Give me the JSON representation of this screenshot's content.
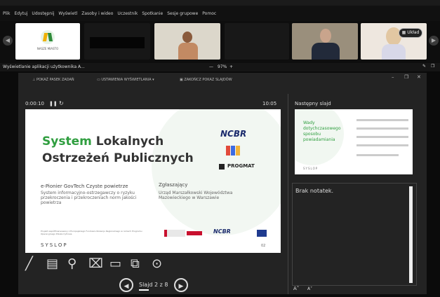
{
  "menu": [
    "Plik",
    "Edytuj",
    "Udostępnij",
    "Wyświetl",
    "Zasoby i wideo",
    "Uczestnik",
    "Spotkanie",
    "Sesje grupowe",
    "Pomoc"
  ],
  "gallery": {
    "logo_text": "NASZE MIASTO",
    "layout_label": "Układ"
  },
  "share": {
    "title": "Wyświetlanie aplikacji użytkownika A...",
    "zoom": "97%",
    "zoom_minus": "—",
    "zoom_plus": "+"
  },
  "presenter": {
    "toolbar": {
      "taskbar": "POKAŻ PASEK ZADAŃ",
      "display": "USTAWIENIA WYŚWIETLANIA ▾",
      "end": "ZAKOŃCZ POKAZ SLAJDÓW"
    },
    "timer": "0:00:10",
    "clock": "10:05",
    "next_label": "Następny slajd",
    "notes": "Brak notatek.",
    "slide_counter": "Slajd 2 z 8"
  },
  "slide": {
    "title_green": "System",
    "title_rest1": "Lokalnych",
    "title_line2": "Ostrzeżeń Publicznych",
    "ncbr": "NCBR",
    "progmat": "PROGMAT",
    "product_title": "e-Pionier GovTech Czyste powietrze",
    "product_desc": "System informacyjno-ostrzegawczy o ryzyku przekroczenia i przekroczeniach norm jakości powietrza",
    "applicant_label": "Zgłaszający",
    "applicant": "Urząd Marszałkowski Województwa Mazowieckiego w Warszawie",
    "footer_note": "Projekt współfinansowany z Europejskiego Funduszu Rozwoju Regionalnego w ramach Programu Operacyjnego Polska Cyfrowa",
    "brand": "SYSLOP",
    "page": "02"
  },
  "next_slide": {
    "title": "Wady dotychczasowego sposobu powiadamiania",
    "brand": "SYSLOP"
  }
}
